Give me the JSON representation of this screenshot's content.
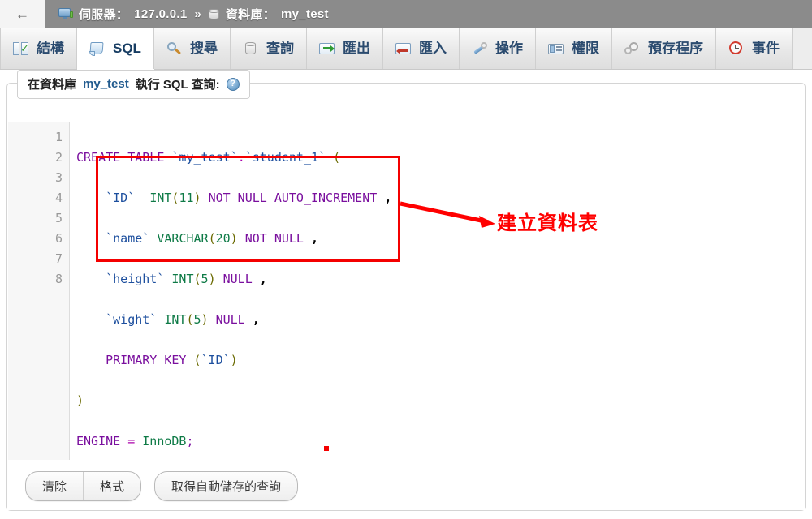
{
  "topbar": {
    "back_label": "←",
    "server_icon": "server-icon",
    "server_label": "伺服器：",
    "server_value": "127.0.0.1",
    "separator": "»",
    "db_icon": "database-icon",
    "db_label": "資料庫：",
    "db_value": "my_test"
  },
  "tabs": [
    {
      "id": "structure",
      "label": "結構",
      "icon": "structure-icon",
      "active": false
    },
    {
      "id": "sql",
      "label": "SQL",
      "icon": "sql-scroll-icon",
      "active": true
    },
    {
      "id": "search",
      "label": "搜尋",
      "icon": "magnifier-icon",
      "active": false
    },
    {
      "id": "query",
      "label": "查詢",
      "icon": "database-icon",
      "active": false
    },
    {
      "id": "export",
      "label": "匯出",
      "icon": "export-icon",
      "active": false
    },
    {
      "id": "import",
      "label": "匯入",
      "icon": "import-icon",
      "active": false
    },
    {
      "id": "operations",
      "label": "操作",
      "icon": "wrench-icon",
      "active": false
    },
    {
      "id": "privileges",
      "label": "權限",
      "icon": "id-card-icon",
      "active": false
    },
    {
      "id": "routines",
      "label": "預存程序",
      "icon": "gears-icon",
      "active": false
    },
    {
      "id": "events",
      "label": "事件",
      "icon": "clock-icon",
      "active": false
    }
  ],
  "fieldset": {
    "legend_prefix": "在資料庫",
    "legend_db": "my_test",
    "legend_suffix": "執行 SQL 查詢:",
    "help_icon": "help-question-icon",
    "help_glyph": "?"
  },
  "editor": {
    "line_numbers": [
      "1",
      "2",
      "3",
      "4",
      "5",
      "6",
      "7",
      "8"
    ],
    "lines": [
      "CREATE TABLE `my_test`.`student_1` (",
      "    `ID`  INT(11) NOT NULL AUTO_INCREMENT ,",
      "    `name` VARCHAR(20) NOT NULL ,",
      "    `height` INT(5) NULL ,",
      "    `wight` INT(5) NULL ,",
      "    PRIMARY KEY (`ID`)",
      ")",
      "ENGINE = InnoDB;"
    ],
    "full_query": "CREATE TABLE `my_test`.`student_1` (\n    `ID`  INT(11) NOT NULL AUTO_INCREMENT ,\n    `name` VARCHAR(20) NOT NULL ,\n    `height` INT(5) NULL ,\n    `wight` INT(5) NULL ,\n    PRIMARY KEY (`ID`)\n)\nENGINE = InnoDB;",
    "tokens": {
      "l1": [
        "CREATE TABLE ",
        "`my_test`",
        ".",
        "`student_1`",
        " ("
      ],
      "l2": [
        "`ID`",
        "INT",
        "(",
        "11",
        ")",
        "NOT NULL AUTO_INCREMENT",
        ","
      ],
      "l3": [
        "`name`",
        "VARCHAR",
        "(",
        "20",
        ")",
        "NOT NULL",
        ","
      ],
      "l4": [
        "`height`",
        "INT",
        "(",
        "5",
        ")",
        "NULL",
        ","
      ],
      "l5": [
        "`wight`",
        "INT",
        "(",
        "5",
        ")",
        "NULL",
        ","
      ],
      "l6": [
        "PRIMARY KEY",
        "(",
        "`ID`",
        ")"
      ],
      "l7": [
        ")"
      ],
      "l8": [
        "ENGINE",
        "=",
        "InnoDB",
        ";"
      ]
    }
  },
  "annotation": {
    "label": "建立資料表",
    "color": "#ff0000",
    "box_color": "#f40000",
    "arrow_name": "red-arrow",
    "dot_name": "red-dot-marker"
  },
  "buttons": {
    "clear": "清除",
    "format": "格式",
    "get_autosaved": "取得自動儲存的查詢"
  },
  "colors": {
    "topbar_bg": "#8b8b8b",
    "tab_text": "#2b4b6f",
    "accent_blue": "#235c8f",
    "keyword": "#7a0f9e",
    "identifier": "#1d4f9e",
    "type": "#0e7a46",
    "annotation_red": "#ff0000"
  }
}
